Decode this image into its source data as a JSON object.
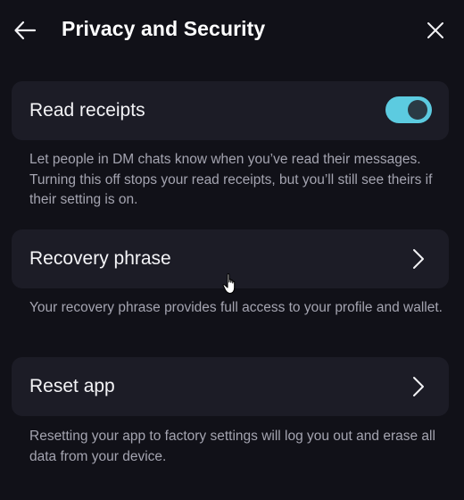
{
  "header": {
    "title": "Privacy and Security",
    "back_icon": "arrow-left-icon",
    "close_icon": "close-icon"
  },
  "settings": [
    {
      "label": "Read receipts",
      "control": "toggle",
      "toggle_on": true,
      "description": "Let people in DM chats know when you’ve read their messages. Turning this off stops your read receipts, but you’ll still see theirs if their setting is on."
    },
    {
      "label": "Recovery phrase",
      "control": "chevron",
      "description": "Your recovery phrase provides full access to your profile and wallet."
    },
    {
      "label": "Reset app",
      "control": "chevron",
      "description": "Resetting your app to factory settings will log you out and erase all data from your device."
    }
  ],
  "colors": {
    "background": "#111118",
    "card": "#1c1c26",
    "accent": "#5ccbe0",
    "text_primary": "#f4f4f7",
    "text_secondary": "#a4a4b0"
  }
}
